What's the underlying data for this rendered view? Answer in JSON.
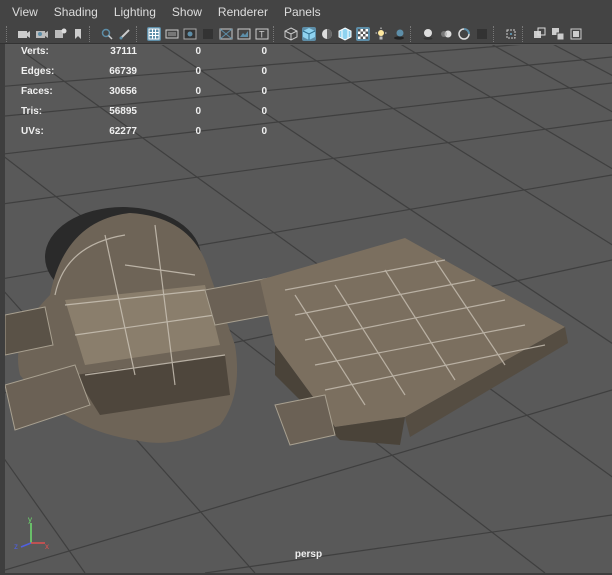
{
  "menu": [
    {
      "id": "view",
      "label": "View"
    },
    {
      "id": "shading",
      "label": "Shading"
    },
    {
      "id": "lighting",
      "label": "Lighting"
    },
    {
      "id": "show",
      "label": "Show"
    },
    {
      "id": "renderer",
      "label": "Renderer"
    },
    {
      "id": "panels",
      "label": "Panels"
    }
  ],
  "hud": {
    "rows": [
      {
        "label": "Verts:",
        "v1": "37111",
        "v2": "0",
        "v3": "0"
      },
      {
        "label": "Edges:",
        "v1": "66739",
        "v2": "0",
        "v3": "0"
      },
      {
        "label": "Faces:",
        "v1": "30656",
        "v2": "0",
        "v3": "0"
      },
      {
        "label": "Tris:",
        "v1": "56895",
        "v2": "0",
        "v3": "0"
      },
      {
        "label": "UVs:",
        "v1": "62277",
        "v2": "0",
        "v3": "0"
      }
    ]
  },
  "camera": {
    "name": "persp"
  },
  "axis": {
    "x": "x",
    "y": "y",
    "z": "z"
  },
  "toolbar_icons": [
    "select-camera-icon",
    "camera-attributes-icon",
    "bookmarks-icon",
    "image-plane-icon",
    "2d-pan-zoom-icon",
    "grease-pencil-icon",
    "grid-icon",
    "film-gate-icon",
    "resolution-gate-icon",
    "gate-mask-icon",
    "field-chart-icon",
    "safe-action-icon",
    "safe-title-icon",
    "wireframe-icon",
    "smooth-shade-icon",
    "default-material-icon",
    "wireframe-on-shaded-icon",
    "textured-icon",
    "use-all-lights-icon",
    "shadows-icon",
    "screen-space-ao-icon",
    "motion-blur-icon",
    "multisample-aa-icon",
    "depth-of-field-icon",
    "isolate-select-icon",
    "xray-icon",
    "xray-joints-icon",
    "xray-components-icon"
  ]
}
